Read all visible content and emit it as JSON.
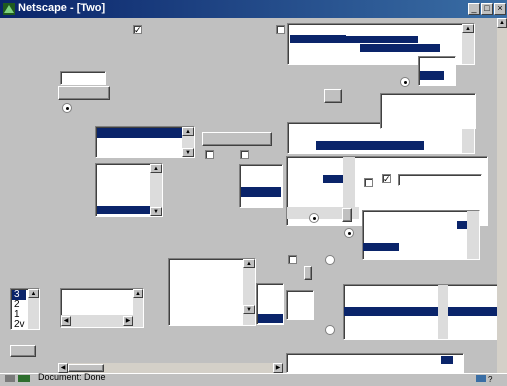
{
  "window": {
    "title": "Netscape - [Two]",
    "buttons": {
      "minimize": "_",
      "maximize": "□",
      "close": "×"
    }
  },
  "listbox": {
    "items": [
      "3",
      "2",
      "1",
      "2v"
    ],
    "selected": "3"
  },
  "status": {
    "text": "Document: Done"
  },
  "colors": {
    "titlebar": "#0a246a",
    "selection": "#0a246a",
    "face": "#c0c0c0"
  }
}
